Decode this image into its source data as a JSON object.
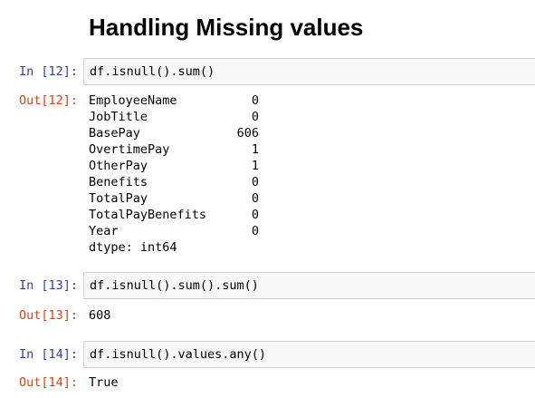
{
  "heading": "Handling Missing values",
  "cells": [
    {
      "in_prompt": "In [12]:",
      "code": "df.isnull().sum()",
      "out_prompt": "Out[12]:",
      "series": [
        {
          "name": "EmployeeName",
          "value": "0"
        },
        {
          "name": "JobTitle",
          "value": "0"
        },
        {
          "name": "BasePay",
          "value": "606"
        },
        {
          "name": "OvertimePay",
          "value": "1"
        },
        {
          "name": "OtherPay",
          "value": "1"
        },
        {
          "name": "Benefits",
          "value": "0"
        },
        {
          "name": "TotalPay",
          "value": "0"
        },
        {
          "name": "TotalPayBenefits",
          "value": "0"
        },
        {
          "name": "Year",
          "value": "0"
        }
      ],
      "dtype": "dtype: int64"
    },
    {
      "in_prompt": "In [13]:",
      "code": "df.isnull().sum().sum()",
      "out_prompt": "Out[13]:",
      "output": "608"
    },
    {
      "in_prompt": "In [14]:",
      "code": "df.isnull().values.any()",
      "out_prompt": "Out[14]:",
      "output": "True"
    }
  ]
}
